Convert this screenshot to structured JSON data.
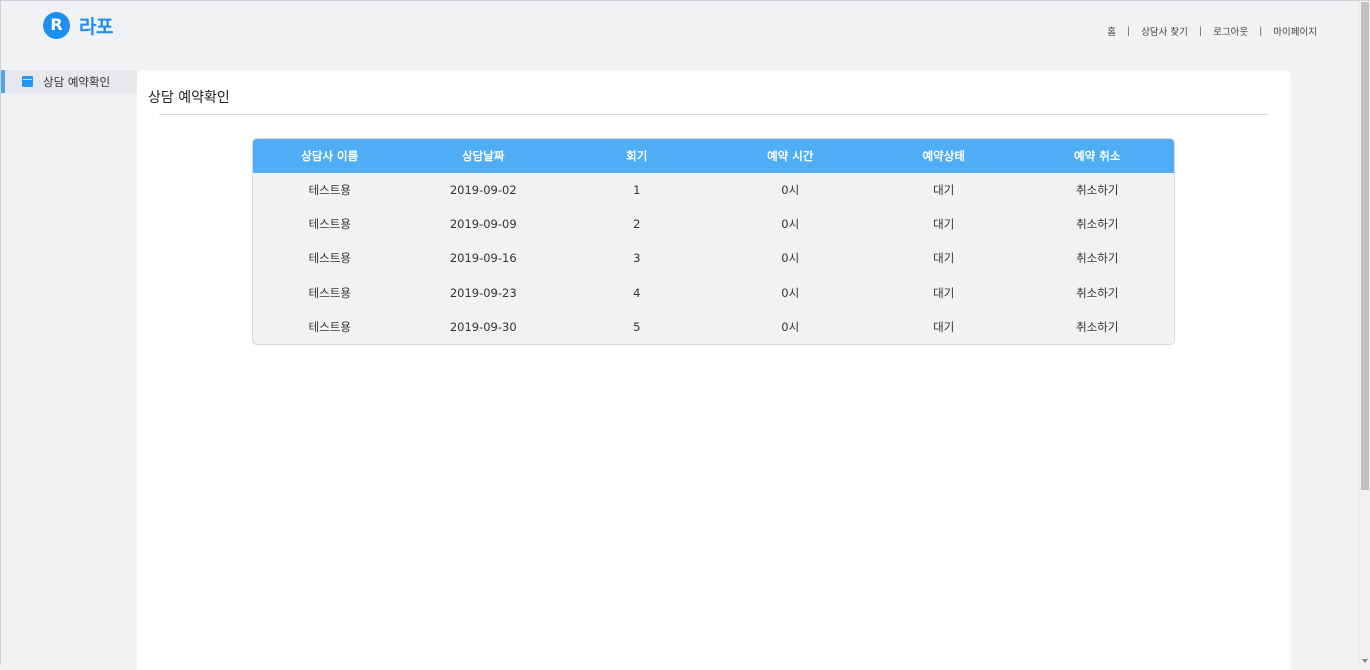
{
  "logo": {
    "mark": "R",
    "text": "라포",
    "brand_color": "#1e8ef2"
  },
  "topnav": {
    "items": [
      {
        "label": "홈"
      },
      {
        "label": "상담사 찾기"
      },
      {
        "label": "로그아웃"
      },
      {
        "label": "마이페이지"
      }
    ],
    "separator": "|"
  },
  "sidebar": {
    "items": [
      {
        "label": "상담 예약확인",
        "icon": "calendar-icon",
        "active": true
      }
    ],
    "accent_color": "#4fa6f1"
  },
  "main": {
    "title": "상담 예약확인"
  },
  "table": {
    "header_color": "#4fadf5",
    "columns": [
      "상담사 이름",
      "상담날짜",
      "회기",
      "예약 시간",
      "예약상태",
      "예약 취소"
    ],
    "rows": [
      {
        "counselor": "테스트용",
        "date": "2019-09-02",
        "session": "1",
        "time": "0시",
        "status": "대기",
        "cancel": "취소하기"
      },
      {
        "counselor": "테스트용",
        "date": "2019-09-09",
        "session": "2",
        "time": "0시",
        "status": "대기",
        "cancel": "취소하기"
      },
      {
        "counselor": "테스트용",
        "date": "2019-09-16",
        "session": "3",
        "time": "0시",
        "status": "대기",
        "cancel": "취소하기"
      },
      {
        "counselor": "테스트용",
        "date": "2019-09-23",
        "session": "4",
        "time": "0시",
        "status": "대기",
        "cancel": "취소하기"
      },
      {
        "counselor": "테스트용",
        "date": "2019-09-30",
        "session": "5",
        "time": "0시",
        "status": "대기",
        "cancel": "취소하기"
      }
    ]
  }
}
